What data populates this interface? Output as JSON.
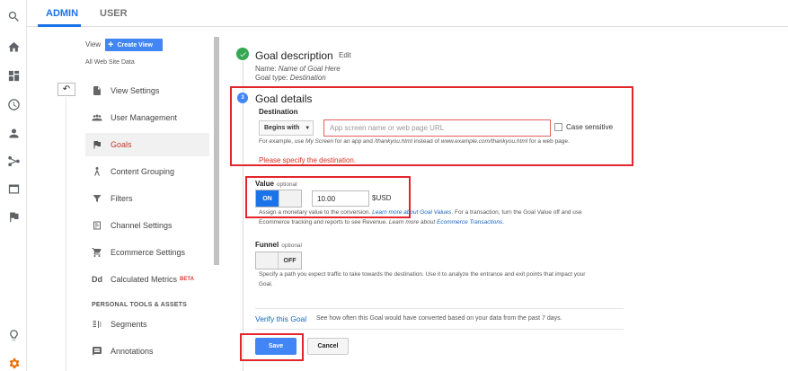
{
  "tabs": {
    "admin": "ADMIN",
    "user": "USER"
  },
  "view_header": {
    "view_label": "View",
    "create_view": "Create View",
    "view_name": "All Web Site Data"
  },
  "rail_icons": [
    "search-icon",
    "home-icon",
    "customization-icon",
    "clock-icon",
    "person-icon",
    "acquisition-icon",
    "behavior-icon",
    "flag-icon",
    "lightbulb-icon",
    "gear-icon"
  ],
  "nav": {
    "items": [
      {
        "label": "View Settings",
        "icon": "document-icon"
      },
      {
        "label": "User Management",
        "icon": "users-icon"
      },
      {
        "label": "Goals",
        "icon": "flag-icon",
        "active": true
      },
      {
        "label": "Content Grouping",
        "icon": "grouping-icon"
      },
      {
        "label": "Filters",
        "icon": "filter-icon"
      },
      {
        "label": "Channel Settings",
        "icon": "channel-icon"
      },
      {
        "label": "Ecommerce Settings",
        "icon": "cart-icon"
      },
      {
        "label": "Calculated Metrics",
        "icon": "dd-icon",
        "badge": "BETA"
      }
    ],
    "section_heading": "PERSONAL TOOLS & ASSETS",
    "tools": [
      {
        "label": "Segments",
        "icon": "segments-icon"
      },
      {
        "label": "Annotations",
        "icon": "annotations-icon"
      }
    ]
  },
  "goal_description": {
    "title": "Goal description",
    "edit": "Edit",
    "name_label": "Name:",
    "name_value": "Name of Goal Here",
    "type_label": "Goal type:",
    "type_value": "Destination"
  },
  "goal_details": {
    "step": "3",
    "title": "Goal details",
    "destination_label": "Destination",
    "match_type": "Begins with",
    "destination_placeholder": "App screen name or web page URL",
    "case_sensitive": "Case sensitive",
    "help_prefix": "For example, use ",
    "help_my_screen": "My Screen",
    "help_middle": " for an app and ",
    "help_thankyou": "/thankyou.html",
    "help_middle2": " instead of ",
    "help_full_url": "www.example.com/thankyou.html",
    "help_suffix": " for a web page.",
    "error": "Please specify the destination."
  },
  "value": {
    "label": "Value",
    "optional": "optional",
    "toggle": "ON",
    "amount": "10.00",
    "currency": "$USD",
    "help_line1_a": "Assign a monetary value to the conversion. ",
    "help_line1_link": "Learn more about Goal Values",
    "help_line1_b": ". For a transaction, turn the Goal Value off and use",
    "help_line2_a": "Ecommerce tracking and reports to see Revenue. ",
    "help_line2_link_a": "Learn more about ",
    "help_line2_link_b": "Ecommerce Transactions",
    "help_line2_b": "."
  },
  "funnel": {
    "label": "Funnel",
    "optional": "optional",
    "toggle": "OFF",
    "help_line1": "Specify a path you expect traffic to take towards the destination. Use it to analyze the entrance and exit points that impact your",
    "help_line2": "Goal."
  },
  "verify": {
    "link": "Verify this Goal",
    "desc": "See how often this Goal would have converted based on your data from the past 7 days."
  },
  "actions": {
    "save": "Save",
    "cancel": "Cancel"
  },
  "colors": {
    "accent": "#4285f4",
    "active_nav": "#c0392b",
    "error": "#d93025",
    "highlight_box": "#e3262c",
    "success": "#34a853",
    "gear": "#e8710a"
  }
}
